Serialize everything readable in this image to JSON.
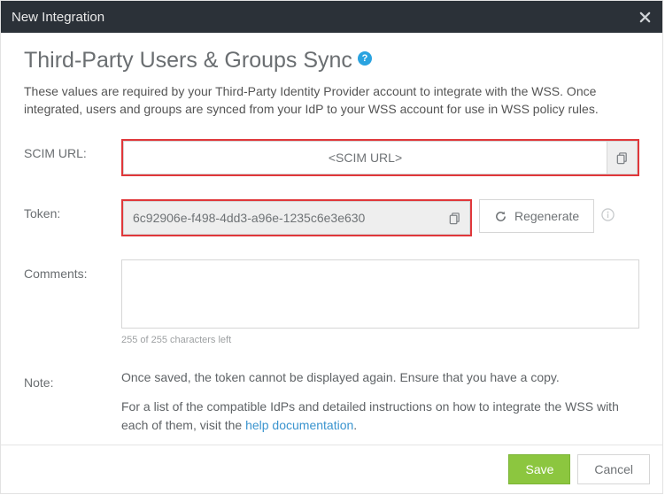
{
  "titlebar": {
    "title": "New Integration"
  },
  "heading": "Third-Party Users & Groups Sync",
  "help_badge": "?",
  "intro": "These values are required by your Third-Party Identity Provider account to integrate with the WSS. Once integrated, users and groups are synced from your IdP to your WSS account for use in WSS policy rules.",
  "fields": {
    "scim_url": {
      "label": "SCIM URL:",
      "value": "<SCIM URL>"
    },
    "token": {
      "label": "Token:",
      "value": "6c92906e-f498-4dd3-a96e-1235c6e3e630",
      "regenerate_label": "Regenerate"
    },
    "comments": {
      "label": "Comments:",
      "value": "",
      "counter": "255 of 255 characters left"
    },
    "note": {
      "label": "Note:",
      "line1": "Once saved, the token cannot be displayed again. Ensure that you have a copy.",
      "line2_pre": "For a list of the compatible IdPs and detailed instructions on how to integrate the WSS with each of them, visit the ",
      "line2_link": "help documentation",
      "line2_post": "."
    }
  },
  "footer": {
    "save": "Save",
    "cancel": "Cancel"
  }
}
